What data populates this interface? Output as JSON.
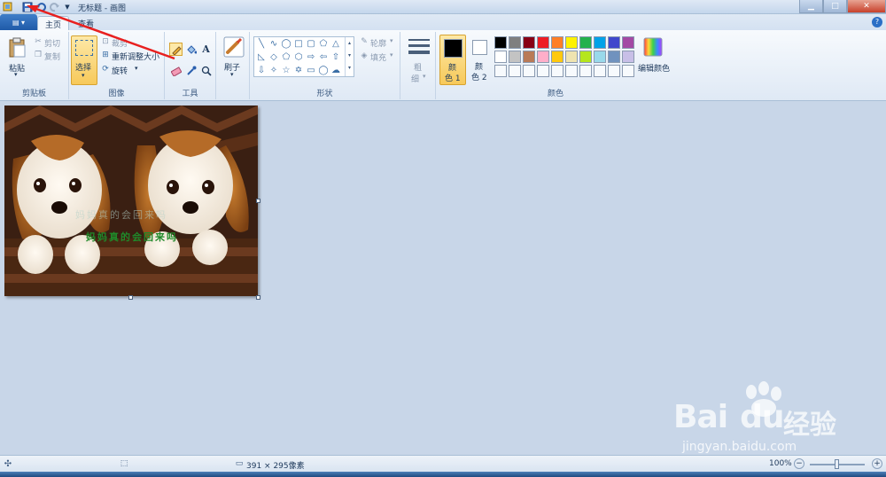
{
  "titlebar": {
    "title": "无标题 - 画图"
  },
  "tabs": {
    "home": "主页",
    "view": "查看"
  },
  "clipboard": {
    "paste": "粘贴",
    "cut": "剪切",
    "copy": "复制",
    "label": "剪贴板"
  },
  "image": {
    "select": "选择",
    "crop": "裁剪",
    "resize": "重新调整大小",
    "rotate": "旋转",
    "label": "图像"
  },
  "tools": {
    "label": "工具",
    "text_glyph": "A"
  },
  "brushes": {
    "label": "刷子"
  },
  "shapes": {
    "label": "形状",
    "outline": "轮廓",
    "fill": "填充"
  },
  "size": {
    "label_1": "粗",
    "label_2": "细"
  },
  "colors": {
    "color1_a": "颜",
    "color1_b": "色 1",
    "color2_a": "颜",
    "color2_b": "色 2",
    "edit": "编辑颜色",
    "label": "颜色",
    "palette_row1": [
      "#000000",
      "#7f7f7f",
      "#880015",
      "#ed1c24",
      "#ff7f27",
      "#fff200",
      "#22b14c",
      "#00a2e8",
      "#3f48cc",
      "#a349a4"
    ],
    "palette_row2": [
      "#ffffff",
      "#c3c3c3",
      "#b97a57",
      "#ffaec9",
      "#ffc90e",
      "#efe4b0",
      "#b5e61d",
      "#99d9ea",
      "#7092be",
      "#c8bfe7"
    ]
  },
  "canvas": {
    "caption_faint": "妈妈真的会回来吗",
    "caption": "妈妈真的会回来吗"
  },
  "status": {
    "dimensions": "391 × 295像素",
    "zoom": "100%"
  },
  "watermark": {
    "brand": "Bai",
    "brand2": "du",
    "cn": "经验",
    "url": "jingyan.baidu.com"
  }
}
